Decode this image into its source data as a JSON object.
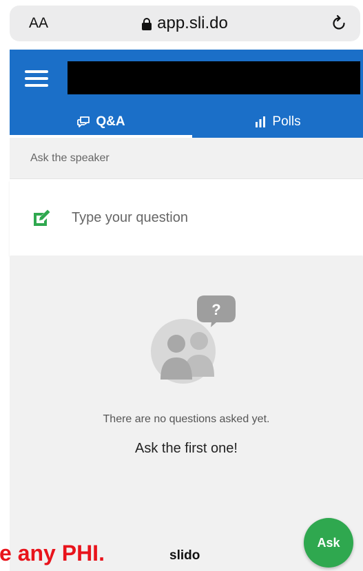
{
  "browser": {
    "text_size_label": "AA",
    "url": "app.sli.do",
    "lock_icon": "lock-icon",
    "reload_icon": "reload-icon"
  },
  "header": {
    "menu_icon": "menu-icon",
    "color": "#1b6fc8",
    "tabs": [
      {
        "label": "Q&A",
        "icon": "comments-icon",
        "active": true
      },
      {
        "label": "Polls",
        "icon": "bar-chart-icon",
        "active": false
      }
    ]
  },
  "ask": {
    "section_label": "Ask the speaker",
    "placeholder": "Type your question",
    "edit_icon": "edit-icon",
    "accent": "#2fa84f"
  },
  "empty_state": {
    "illustration": "people-question-icon",
    "message": "There are no questions asked yet.",
    "cta": "Ask the first one!"
  },
  "footer": {
    "warning_text": "e any PHI.",
    "warning_color": "#e8141c",
    "brand": "slido",
    "fab_label": "Ask"
  }
}
